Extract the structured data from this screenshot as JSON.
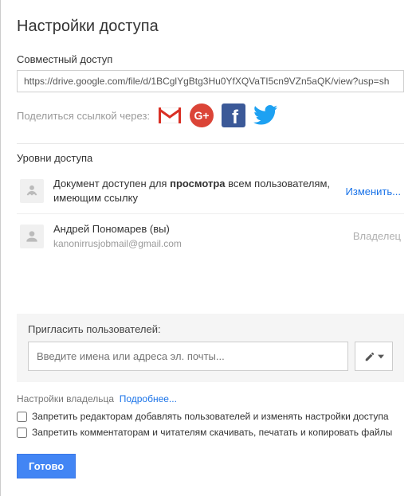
{
  "title": "Настройки доступа",
  "shared": {
    "label": "Совместный доступ",
    "url": "https://drive.google.com/file/d/1BCglYgBtg3Hu0YfXQVaTI5cn9VZn5aQK/view?usp=sh"
  },
  "shareVia": {
    "label": "Поделиться ссылкой через:",
    "icons": [
      "gmail",
      "google-plus",
      "facebook",
      "twitter"
    ]
  },
  "accessLevels": {
    "label": "Уровни доступа"
  },
  "entries": [
    {
      "text_prefix": "Документ доступен для ",
      "text_bold": "просмотра",
      "text_suffix": " всем пользователям, имеющим ссылку",
      "action": "Изменить..."
    },
    {
      "name": "Андрей Пономарев (вы)",
      "email": "kanonirrusjobmail@gmail.com",
      "role": "Владелец"
    }
  ],
  "invite": {
    "title": "Пригласить пользователей:",
    "placeholder": "Введите имена или адреса эл. почты..."
  },
  "ownerSettings": {
    "label": "Настройки владельца",
    "more": "Подробнее...",
    "opt1": "Запретить редакторам добавлять пользователей и изменять настройки доступа",
    "opt2": "Запретить комментаторам и читателям скачивать, печатать и копировать файлы"
  },
  "done": "Готово"
}
